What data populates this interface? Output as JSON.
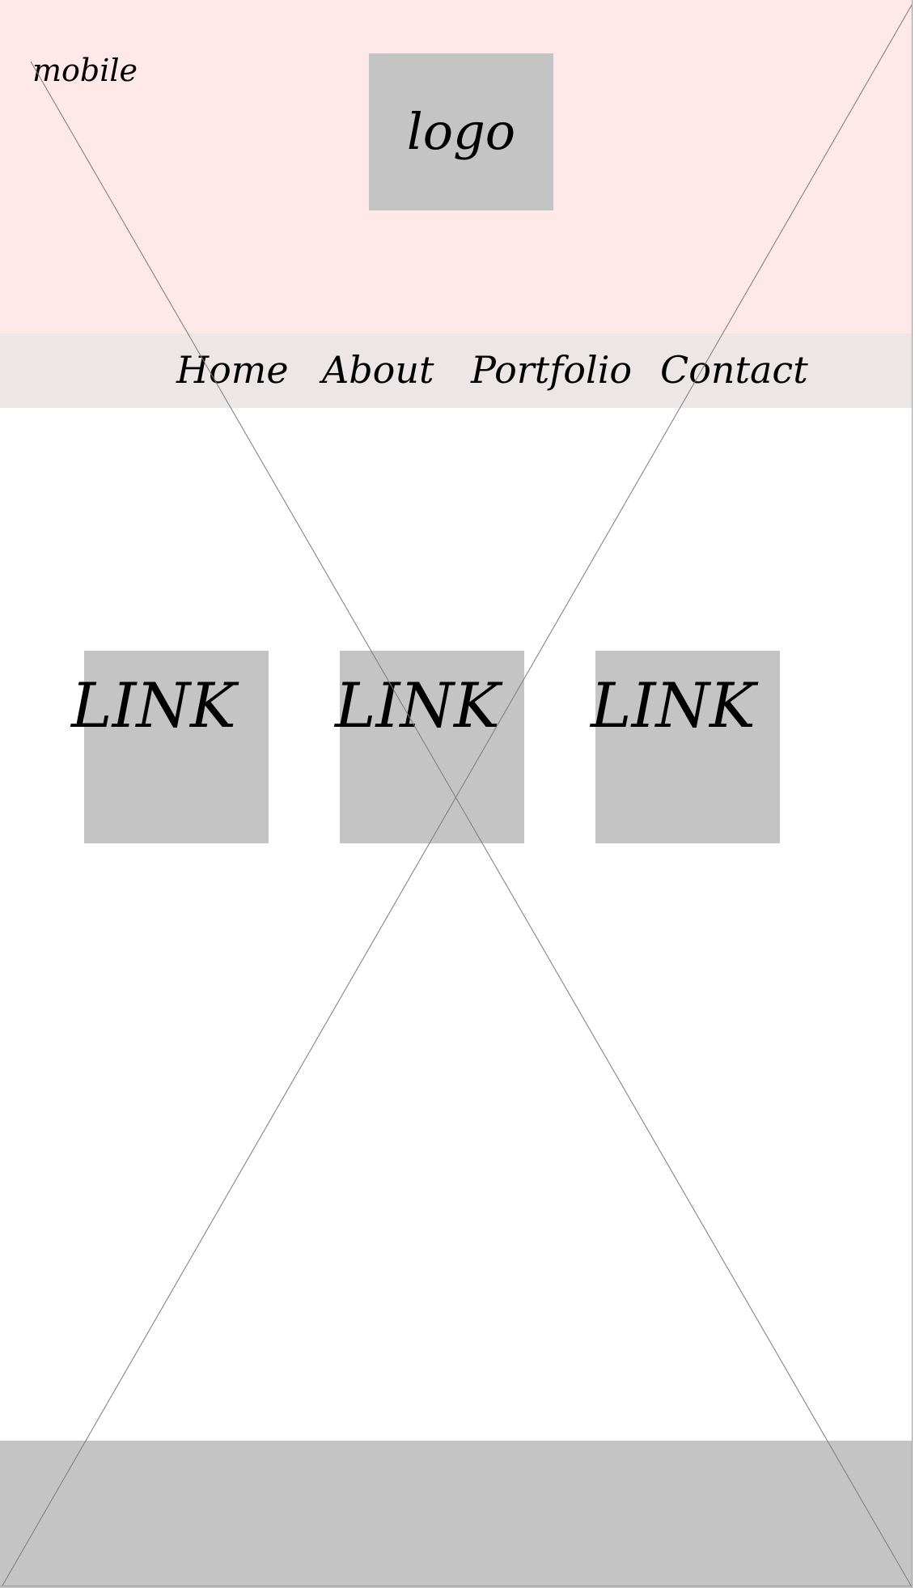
{
  "header": {
    "device_label": "mobile",
    "logo_text": "logo",
    "background_color": "#ffe8e8"
  },
  "nav": {
    "background_color": "#ede6e6",
    "items": [
      {
        "label": "Home"
      },
      {
        "label": "About"
      },
      {
        "label": "Portfolio"
      },
      {
        "label": "Contact"
      }
    ]
  },
  "main": {
    "tiles": [
      {
        "label": "LINK"
      },
      {
        "label": "LINK"
      },
      {
        "label": "LINK"
      }
    ],
    "tile_color": "#c4c4c4"
  },
  "footer": {
    "background_color": "#c4c4c4"
  }
}
